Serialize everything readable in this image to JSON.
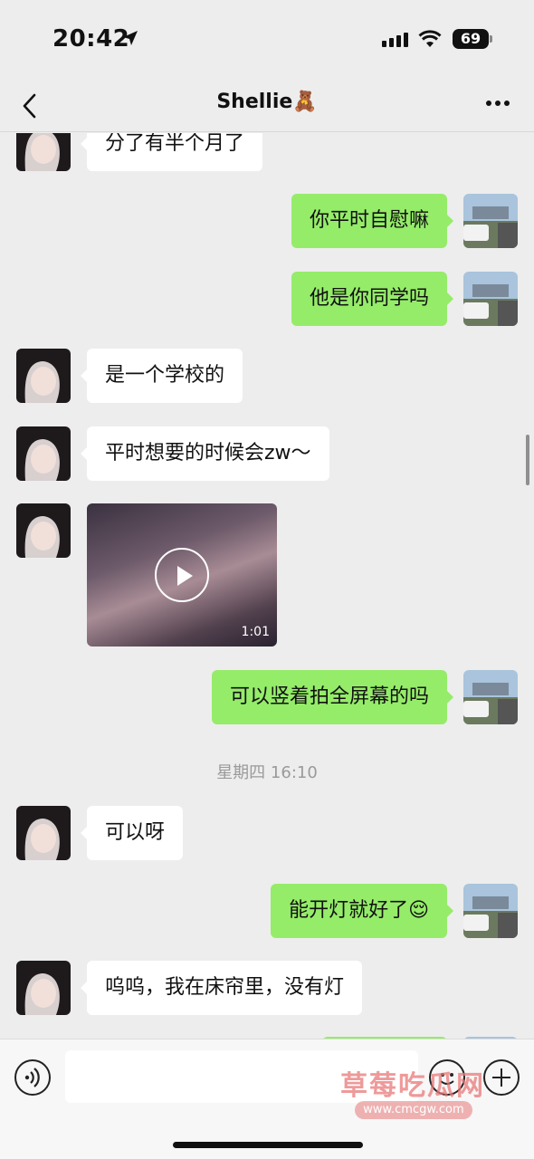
{
  "status_bar": {
    "time": "20:42",
    "battery": "69"
  },
  "nav": {
    "title": "Shellie🧸",
    "back_icon": "chevron-left-icon",
    "more_icon": "ellipsis-icon"
  },
  "messages": [
    {
      "side": "left",
      "text": "分了有半个月了"
    },
    {
      "side": "right",
      "text": "你平时自慰嘛"
    },
    {
      "side": "right",
      "text": "他是你同学吗"
    },
    {
      "side": "left",
      "text": "是一个学校的"
    },
    {
      "side": "left",
      "text": "平时想要的时候会zw～"
    },
    {
      "side": "left",
      "type": "video",
      "duration": "1:01"
    },
    {
      "side": "right",
      "text": "可以竖着拍全屏幕的吗"
    },
    {
      "type": "timestamp",
      "text": "星期四 16:10"
    },
    {
      "side": "left",
      "text": "可以呀"
    },
    {
      "side": "right",
      "text": "能开灯就好了😌"
    },
    {
      "side": "left",
      "text": "呜呜，我在床帘里，没有灯"
    }
  ],
  "input_bar": {
    "voice_icon": "voice-icon",
    "emoji_icon": "emoji-icon",
    "plus_icon": "plus-icon",
    "input_value": ""
  },
  "watermark": {
    "title": "草莓吃瓜网",
    "url": "www.cmcgw.com"
  },
  "colors": {
    "background": "#ededed",
    "bubble_self": "#95ec69",
    "bubble_other": "#ffffff"
  }
}
